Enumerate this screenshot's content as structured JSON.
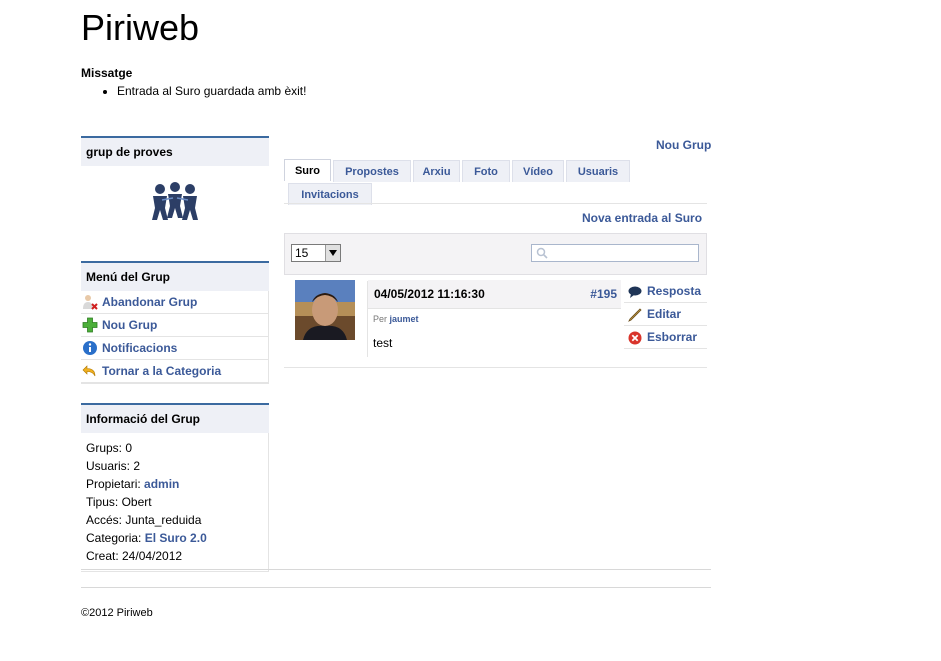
{
  "site": {
    "title": "Piriweb"
  },
  "message": {
    "heading": "Missatge",
    "items": [
      "Entrada al Suro guardada amb èxit!"
    ]
  },
  "group_box": {
    "title": "grup de proves",
    "icon": "group-people-icon"
  },
  "menu": {
    "title": "Menú del Grup",
    "items": [
      {
        "label": "Abandonar Grup",
        "icon": "leave-user-icon"
      },
      {
        "label": "Nou Grup",
        "icon": "add-plus-icon"
      },
      {
        "label": "Notificacions",
        "icon": "info-icon"
      },
      {
        "label": "Tornar a la Categoria",
        "icon": "back-arrow-icon"
      }
    ]
  },
  "info": {
    "title": "Informació del Grup",
    "grups": "Grups: 0",
    "usuaris": "Usuaris: 2",
    "propietari_label": "Propietari:",
    "propietari": "admin",
    "tipus": "Tipus: Obert",
    "acces": "Accés: Junta_reduida",
    "categoria_label": "Categoria:",
    "categoria": "El Suro 2.0",
    "creat": "Creat: 24/04/2012"
  },
  "main": {
    "nou_grup": "Nou Grup",
    "tabs": [
      "Suro",
      "Propostes",
      "Arxiu",
      "Foto",
      "Vídeo",
      "Usuaris",
      "Invitacions"
    ],
    "active_tab": "Suro",
    "nova_entrada": "Nova entrada al Suro",
    "per_page": "15",
    "search_placeholder": ""
  },
  "post": {
    "date": "04/05/2012 11:16:30",
    "number": "#195",
    "by_label": "Per",
    "author": "jaumet",
    "text": "test",
    "actions": [
      {
        "label": "Resposta",
        "icon": "speech-bubble-icon"
      },
      {
        "label": "Editar",
        "icon": "pencil-icon"
      },
      {
        "label": "Esborrar",
        "icon": "delete-icon"
      }
    ]
  },
  "footer": {
    "copyright": "©2012 Piriweb"
  },
  "colors": {
    "link": "#3b5998",
    "box_border": "#3b6aa0",
    "box_head": "#eef0f6"
  }
}
